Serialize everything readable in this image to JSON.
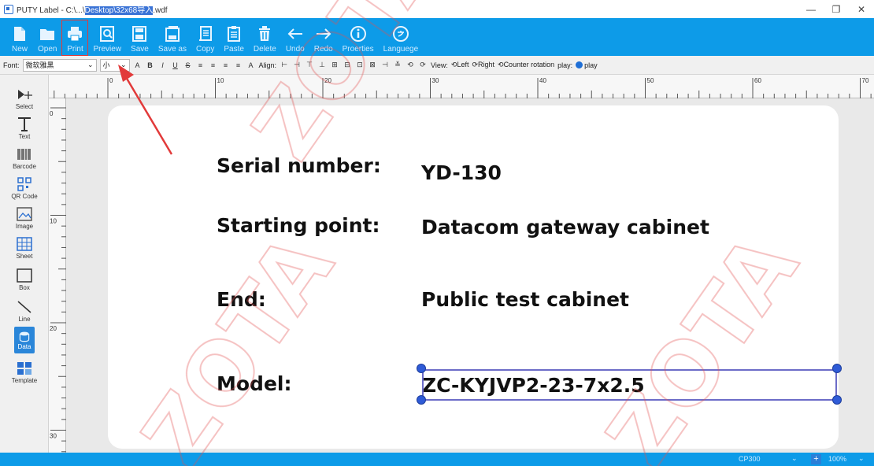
{
  "titlebar": {
    "title_prefix": "PUTY Label - C:\\...\\",
    "title_path_selected": "Desktop\\32x68导入",
    "title_suffix": ".wdf",
    "minimize": "—",
    "maximize": "❐",
    "close": "✕"
  },
  "toolbar": {
    "new": "New",
    "open": "Open",
    "print": "Print",
    "preview": "Preview",
    "save": "Save",
    "save_as": "Save as",
    "copy": "Copy",
    "paste": "Paste",
    "delete": "Delete",
    "undo": "Undo",
    "redo": "Redo",
    "properties": "Proerties",
    "language": "Languege"
  },
  "formatbar": {
    "font_label": "Font:",
    "font_value": "微软雅黑",
    "size_value": "小",
    "align_label": "Align:",
    "view_label": "View:",
    "left_label": "Left",
    "right_label": "Right",
    "counter_rotation": "Counter rotation",
    "play_label": "play:",
    "play_button": "play"
  },
  "sidebar": {
    "items": [
      {
        "label": "Select"
      },
      {
        "label": "Text"
      },
      {
        "label": "Barcode"
      },
      {
        "label": "QR Code"
      },
      {
        "label": "Image"
      },
      {
        "label": "Sheet"
      },
      {
        "label": "Box"
      },
      {
        "label": "Line"
      },
      {
        "label": "Data"
      },
      {
        "label": "Template"
      }
    ]
  },
  "rulers": {
    "h_ticks": [
      "0",
      "10",
      "20",
      "30",
      "40",
      "50",
      "60",
      "70"
    ],
    "v_ticks": [
      "0",
      "10",
      "20",
      "30"
    ]
  },
  "label": {
    "serial_key": "Serial number:",
    "serial_value": "YD-130",
    "start_key": "Starting point:",
    "start_value": "Datacom gateway cabinet",
    "end_key": "End:",
    "end_value": "Public test cabinet",
    "model_key": "Model:",
    "model_value": "ZC-KYJVP2-23-7x2.5"
  },
  "statusbar": {
    "printer": "CP300",
    "zoom": "100%"
  },
  "watermark_text": "ZOTA",
  "colors": {
    "toolbar_bg": "#0d9be8",
    "highlight_red": "#e23a3a",
    "selection": "#6c6cc8",
    "handle": "#2f5bd7"
  }
}
